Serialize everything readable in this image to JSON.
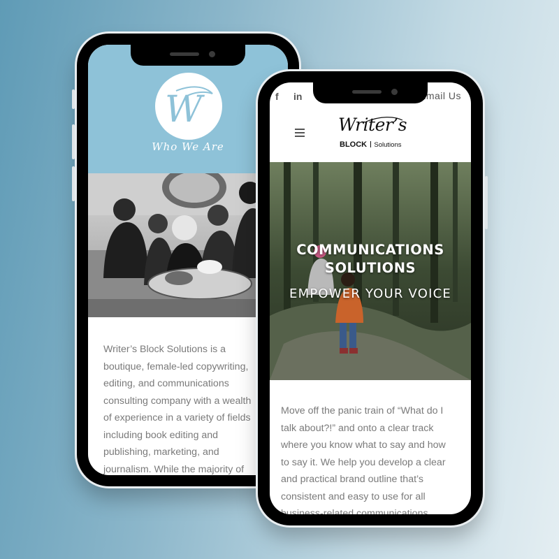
{
  "back_phone": {
    "header": {
      "logo_letter": "W",
      "title": "Who We Are",
      "background": "#8ec2d8"
    },
    "photo": {
      "icon": "team-photo"
    },
    "about_lines": [
      "Writer’s Block Solutions is a",
      "boutique, female-led copywriting,",
      "editing, and communications",
      "consulting company with a wealth",
      "of experience in a variety of fields",
      "including book editing and",
      "publishing, marketing, and",
      "journalism. While the majority of"
    ]
  },
  "front_phone": {
    "topbar": {
      "facebook_icon": "f",
      "linkedin_icon": "in",
      "instagram_icon": "instagram-icon",
      "email_label": "Email Us"
    },
    "brand": {
      "script": "Writer’s",
      "block": "BLOCK",
      "solutions": "Solutions"
    },
    "hero": {
      "title_line1": "COMMUNICATIONS",
      "title_line2": "SOLUTIONS",
      "subtitle": "EMPOWER YOUR VOICE"
    },
    "pitch_lines": [
      "Move off the panic train of “What do I",
      "talk about?!” and onto a clear track",
      "where you know what to say and how",
      "to say it. We help you develop a clear",
      "and practical brand outline that’s",
      "consistent and easy to use for all",
      "business-related communications."
    ]
  },
  "colors": {
    "background_left": "#5f9bb6",
    "background_right": "#e4eef2",
    "body_text": "#7a7a7a",
    "header_blue": "#8ec2d8"
  }
}
